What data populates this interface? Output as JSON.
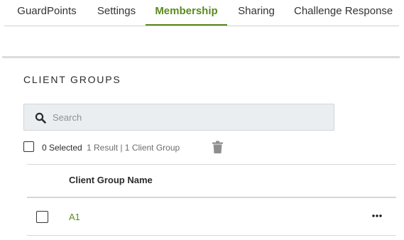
{
  "tabs": [
    {
      "label": "GuardPoints",
      "active": false
    },
    {
      "label": "Settings",
      "active": false
    },
    {
      "label": "Membership",
      "active": true
    },
    {
      "label": "Sharing",
      "active": false
    },
    {
      "label": "Challenge Response",
      "active": false
    }
  ],
  "section": {
    "title": "CLIENT GROUPS"
  },
  "search": {
    "placeholder": "Search",
    "value": "",
    "icon": "search-icon"
  },
  "selection": {
    "count_label": "0 Selected",
    "result_label": "1 Result | 1 Client Group",
    "delete_icon": "trash-icon"
  },
  "table": {
    "columns": [
      "Client Group Name"
    ],
    "rows": [
      {
        "name": "A1",
        "checked": false,
        "actions_icon": "more-horizontal-icon"
      }
    ]
  },
  "colors": {
    "accent": "#5c8a1e",
    "search_bg": "#eaeef0",
    "divider": "#d6d6d6"
  }
}
